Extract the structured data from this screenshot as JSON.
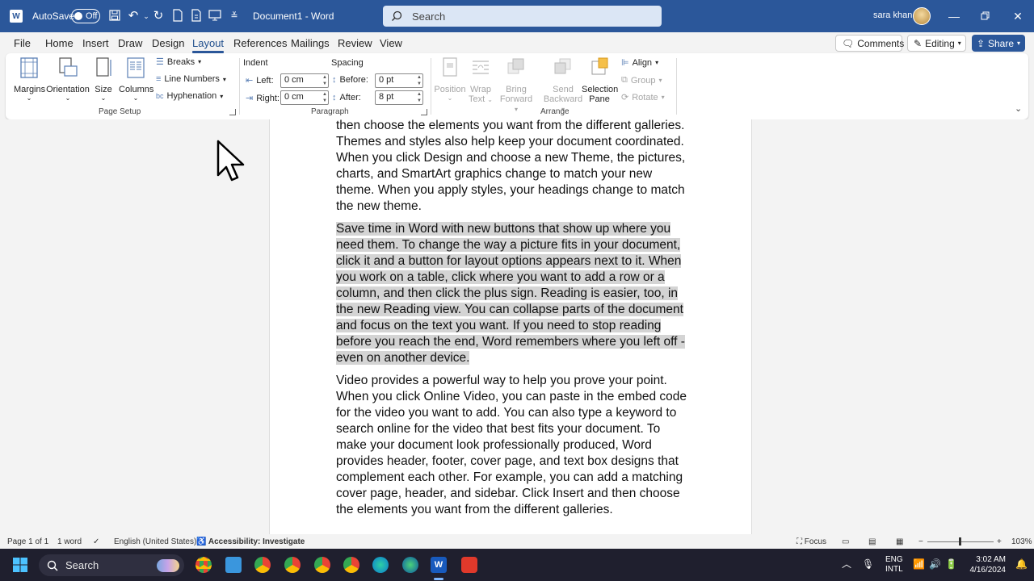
{
  "titlebar": {
    "autosave_label": "AutoSave",
    "autosave_state": "Off",
    "document_title": "Document1 - Word",
    "search_placeholder": "Search",
    "user_name": "sara khan"
  },
  "tabs": [
    "File",
    "Home",
    "Insert",
    "Draw",
    "Design",
    "Layout",
    "References",
    "Mailings",
    "Review",
    "View"
  ],
  "active_tab": "Layout",
  "right_buttons": {
    "comments": "Comments",
    "editing": "Editing",
    "share": "Share"
  },
  "ribbon": {
    "page_setup": {
      "margins": "Margins",
      "orientation": "Orientation",
      "size": "Size",
      "columns": "Columns",
      "breaks": "Breaks",
      "line_numbers": "Line Numbers",
      "hyphenation": "Hyphenation",
      "label": "Page Setup"
    },
    "paragraph": {
      "indent_label": "Indent",
      "spacing_label": "Spacing",
      "left_label": "Left:",
      "left_value": "0 cm",
      "right_label": "Right:",
      "right_value": "0 cm",
      "before_label": "Before:",
      "before_value": "0 pt",
      "after_label": "After:",
      "after_value": "8 pt",
      "label": "Paragraph"
    },
    "arrange": {
      "position": "Position",
      "wrap_text_1": "Wrap",
      "wrap_text_2": "Text",
      "bring_forward_1": "Bring",
      "bring_forward_2": "Forward",
      "send_backward_1": "Send",
      "send_backward_2": "Backward",
      "selection_pane_1": "Selection",
      "selection_pane_2": "Pane",
      "align": "Align",
      "group": "Group",
      "rotate": "Rotate",
      "label": "Arrange"
    }
  },
  "document": {
    "para1": "then choose the elements you want from the different galleries. Themes and styles also help keep your document coordinated. When you click Design and choose a new Theme, the pictures, charts, and SmartArt graphics change to match your new theme. When you apply styles, your headings change to match the new theme.",
    "para2": "Save time in Word with new buttons that show up where you need them. To change the way a picture fits in your document, click it and a button for layout options appears next to it. When you work on a table, click where you want to add a row or a column, and then click the plus sign. Reading is easier, too, in the new Reading view. You can collapse parts of the document and focus on the text you want. If you need to stop reading before you reach the end, Word remembers where you left off - even on another device.",
    "para3": "Video provides a powerful way to help you prove your point. When you click Online Video, you can paste in the embed code for the video you want to add. You can also type a keyword to search online for the video that best fits your document. To make your document look professionally produced, Word provides header, footer, cover page, and text box designs that complement each other. For example, you can add a matching cover page, header, and sidebar. Click Insert and then choose the elements you want from the different galleries."
  },
  "statusbar": {
    "page": "Page 1 of 1",
    "words": "1 word",
    "language": "English (United States)",
    "accessibility": "Accessibility: Investigate",
    "focus": "Focus",
    "zoom": "103%"
  },
  "taskbar": {
    "search": "Search",
    "lang_1": "ENG",
    "lang_2": "INTL",
    "time": "3:02 AM",
    "date": "4/16/2024"
  },
  "colors": {
    "word_blue": "#2b579a",
    "selection_gray": "#d4d4d4",
    "taskbar": "#1f1f2e"
  }
}
